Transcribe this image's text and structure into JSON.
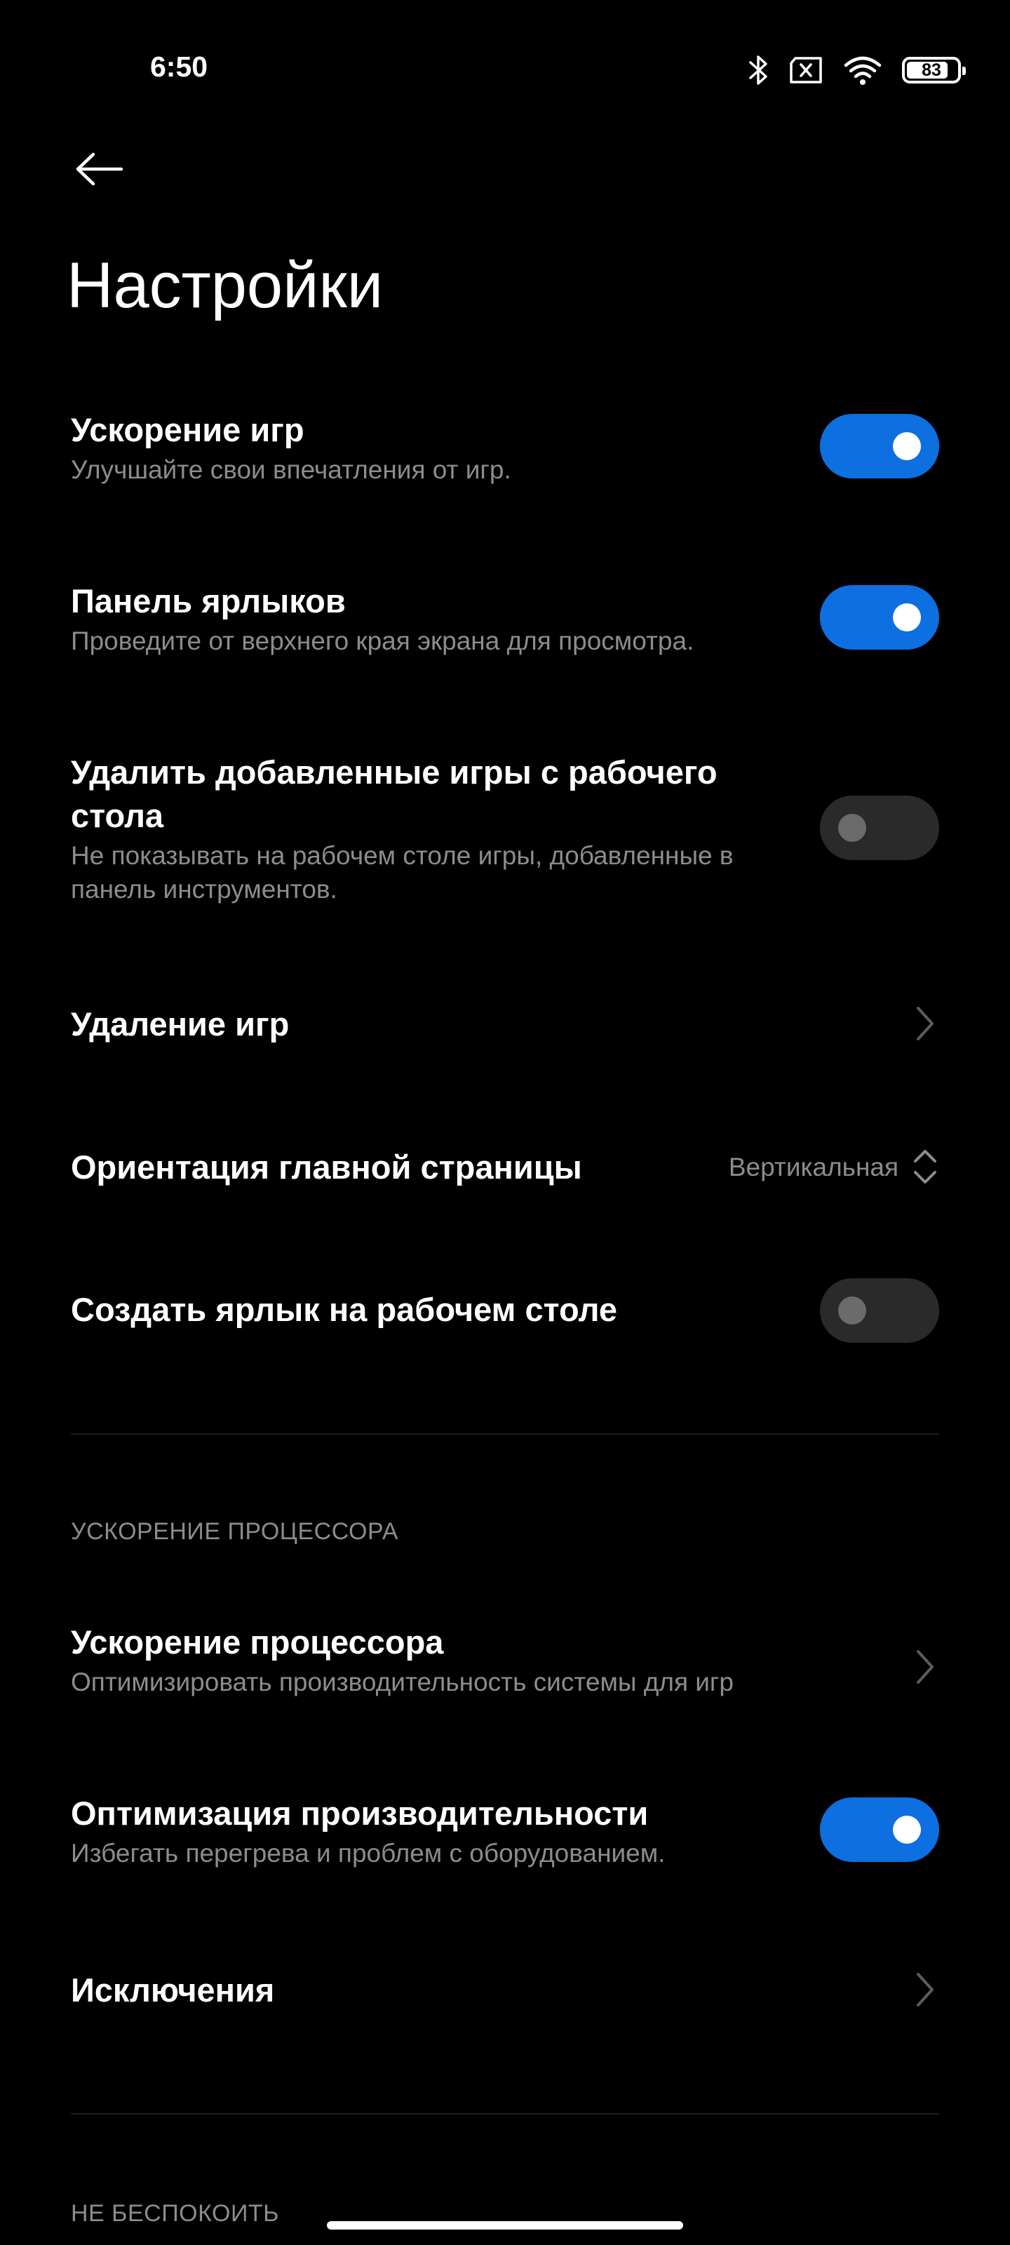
{
  "status_bar": {
    "time": "6:50",
    "battery_level": "83",
    "icons": [
      "bluetooth-icon",
      "no-sim-icon",
      "wifi-icon",
      "battery-icon"
    ]
  },
  "header": {
    "back_icon": "arrow-left-icon",
    "title": "Настройки"
  },
  "settings": [
    {
      "title": "Ускорение игр",
      "subtitle": "Улучшайте свои впечатления от игр.",
      "control": "toggle",
      "enabled": true
    },
    {
      "title": "Панель ярлыков",
      "subtitle": "Проведите от верхнего края экрана для просмотра.",
      "control": "toggle",
      "enabled": true
    },
    {
      "title": "Удалить добавленные игры с рабочего стола",
      "subtitle": "Не показывать на рабочем столе игры, добавленные в панель инструментов.",
      "control": "toggle",
      "enabled": false
    },
    {
      "title": "Удаление игр",
      "control": "chevron"
    },
    {
      "title": "Ориентация главной страницы",
      "value": "Вертикальная",
      "control": "select"
    },
    {
      "title": "Создать ярлык на рабочем столе",
      "control": "toggle",
      "enabled": false
    }
  ],
  "cpu_section": {
    "header": "УСКОРЕНИЕ ПРОЦЕССОРА",
    "items": [
      {
        "title": "Ускорение процессора",
        "subtitle": "Оптимизировать производительность системы для игр",
        "control": "chevron"
      },
      {
        "title": "Оптимизация производительности",
        "subtitle": "Избегать перегрева и проблем с оборудованием.",
        "control": "toggle",
        "enabled": true
      },
      {
        "title": "Исключения",
        "control": "chevron"
      }
    ]
  },
  "dnd_section": {
    "header": "НЕ БЕСПОКОИТЬ"
  },
  "colors": {
    "background": "#000000",
    "accent": "#0d6fe0",
    "secondary_text": "#8c8c8c"
  }
}
